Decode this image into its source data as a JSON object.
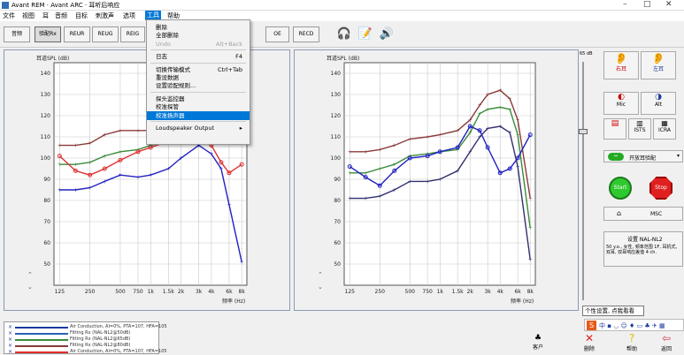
{
  "window": {
    "title": "Avant REM · Avant ARC · 耳听后响应"
  },
  "menu": [
    {
      "label": "文件"
    },
    {
      "label": "视图"
    },
    {
      "label": "耳"
    },
    {
      "label": "音频"
    },
    {
      "label": "目标"
    },
    {
      "label": "刺激声"
    },
    {
      "label": "选项"
    },
    {
      "label": "工具",
      "active": true
    },
    {
      "label": "帮助"
    }
  ],
  "toolbar": {
    "buttons": [
      "音频",
      "验配Rx",
      "REUR",
      "REUG",
      "REIG",
      "OE",
      "RECD"
    ],
    "pressed": "验配Rx"
  },
  "tools_menu": {
    "items": [
      {
        "label": "删除",
        "shortcut": ""
      },
      {
        "label": "全部删除",
        "shortcut": ""
      },
      {
        "label": "Undo",
        "shortcut": "Alt+Back",
        "disabled": true
      },
      {
        "sep": true
      },
      {
        "label": "日志",
        "shortcut": "F4"
      },
      {
        "sep": true
      },
      {
        "label": "切换传输模式",
        "shortcut": "Ctrl+Tab"
      },
      {
        "label": "重设数据",
        "shortcut": ""
      },
      {
        "label": "设置验配规则...",
        "shortcut": ""
      },
      {
        "sep": true
      },
      {
        "label": "探头监控器",
        "shortcut": ""
      },
      {
        "label": "校准探管",
        "shortcut": ""
      },
      {
        "label": "校准扬声器",
        "shortcut": "",
        "highlighted": true
      },
      {
        "sep": true
      },
      {
        "label": "Loudspeaker Output",
        "shortcut": "▸"
      }
    ]
  },
  "charts": {
    "ylabel": "耳道SPL (dB)",
    "xlabel_left": "频率 (Hz)",
    "xlabel_right": "频率 (Hz)",
    "yticks": [
      "140",
      "130",
      "120",
      "110",
      "100",
      "90",
      "80",
      "70",
      "60",
      "50"
    ],
    "xticks": [
      "125",
      "250",
      "500",
      "750",
      "1k",
      "1.5k",
      "2k",
      "3k",
      "4k",
      "6k",
      "8k"
    ]
  },
  "chart_data": [
    {
      "type": "line",
      "title": "",
      "ylabel": "耳道SPL (dB)",
      "xlabel": "频率 (Hz)",
      "x": [
        125,
        180,
        250,
        350,
        500,
        750,
        1000,
        1500,
        2000,
        3000,
        4000,
        5000,
        6000,
        8000
      ],
      "ylim": [
        40,
        145
      ],
      "series": [
        {
          "color": "#8b3a3a",
          "values": [
            106,
            106,
            107,
            111,
            113,
            113,
            113,
            113,
            114,
            116,
            118,
            113,
            null,
            null
          ]
        },
        {
          "color": "#3a8a3a",
          "values": [
            97,
            97,
            98,
            101,
            103,
            104,
            106,
            108,
            110,
            112,
            113,
            108,
            null,
            null
          ]
        },
        {
          "color": "#e03030",
          "values": [
            101,
            94,
            92,
            95,
            99,
            103,
            105,
            108,
            109,
            110,
            106,
            98,
            93,
            97
          ]
        },
        {
          "color": "#2020c0",
          "values": [
            85,
            85,
            86,
            89,
            92,
            91,
            92,
            95,
            100,
            106,
            102,
            95,
            78,
            51
          ]
        }
      ],
      "grid": true
    },
    {
      "type": "line",
      "title": "",
      "ylabel": "耳道SPL (dB)",
      "xlabel": "频率 (Hz)",
      "x": [
        125,
        180,
        250,
        350,
        500,
        750,
        1000,
        1500,
        2000,
        2500,
        3000,
        4000,
        5000,
        6000,
        8000
      ],
      "ylim": [
        40,
        145
      ],
      "series": [
        {
          "color": "#8b3a3a",
          "values": [
            103,
            103,
            104,
            106,
            109,
            110,
            111,
            113,
            118,
            125,
            130,
            132,
            128,
            118,
            81
          ]
        },
        {
          "color": "#3a8a3a",
          "values": [
            93,
            93,
            95,
            97,
            101,
            102,
            103,
            104,
            112,
            121,
            123,
            124,
            123,
            111,
            67
          ]
        },
        {
          "color": "#2020c0",
          "values": [
            96,
            91,
            87,
            94,
            100,
            101,
            103,
            105,
            115,
            113,
            105,
            93,
            95,
            100,
            111
          ]
        },
        {
          "color": "#303070",
          "values": [
            81,
            81,
            82,
            85,
            89,
            89,
            90,
            94,
            103,
            110,
            114,
            115,
            112,
            96,
            52
          ]
        }
      ],
      "grid": true
    }
  ],
  "volume": {
    "label": "65 dB"
  },
  "right_panel": {
    "right_ear": "右耳",
    "left_ear": "左耳",
    "mode_buttons": [
      "Mic",
      "Alt",
      "ISTS",
      "ICRA"
    ],
    "fitting_label": "开放耳验配",
    "start": "Start",
    "stop": "Stop",
    "msc": "MSC",
    "rule_title": "设置 NAL-NL2",
    "rule_desc": "50 y.o., 女性, 频率范围 1F, 耳机式, 双耳, 双耳响应差值 4 ch."
  },
  "legend": [
    {
      "color": "#1b3a9e",
      "text": "Air Conduction, AI=0%, PTA=107, HFA=105"
    },
    {
      "color": "#2b62b8",
      "text": "Fitting Rx (NAL-NL2@50dB)"
    },
    {
      "color": "#3a8a3a",
      "text": "Fitting Rx (NAL-NL2@65dB)"
    },
    {
      "color": "#8b3a3a",
      "text": "Fitting Rx (NAL-NL2@80dB)"
    },
    {
      "color": "#e03030",
      "text": "Air Conduction, AI=0%, PTA=107, HFA=105"
    }
  ],
  "tooltip": "个性设置, 点我看看",
  "bottom_bar": {
    "client": "客户",
    "delete": "删除",
    "help": "帮助",
    "back": "返回"
  }
}
